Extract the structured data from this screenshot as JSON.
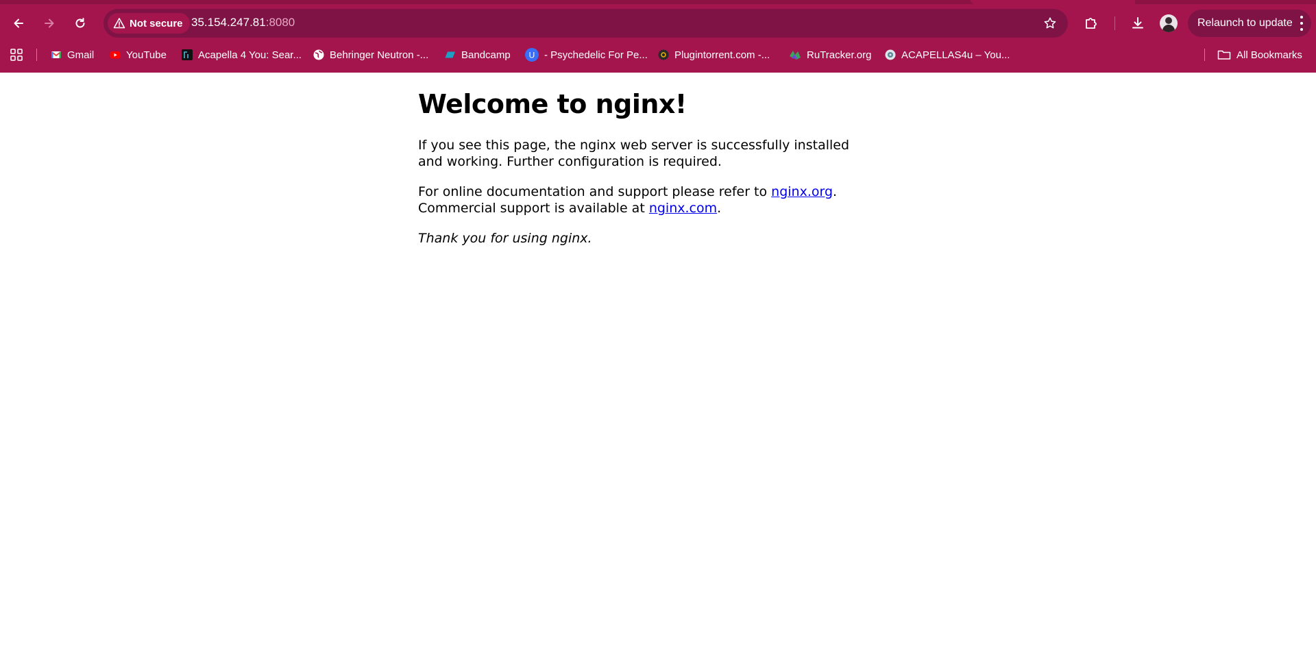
{
  "browser": {
    "security_chip": "Not secure",
    "url_host": "35.154.247.81",
    "url_port": ":8080",
    "relaunch_label": "Relaunch to update",
    "bookmarks": [
      {
        "label": "Gmail",
        "icon": "gmail-icon"
      },
      {
        "label": "YouTube",
        "icon": "youtube-icon"
      },
      {
        "label": "Acapella 4 You: Sear...",
        "icon": "acapella-icon"
      },
      {
        "label": "Behringer Neutron -...",
        "icon": "globe-icon"
      },
      {
        "label": "Bandcamp",
        "icon": "bandcamp-icon"
      },
      {
        "label": "- Psychedelic For Pe...",
        "icon": "u-icon"
      },
      {
        "label": "Plugintorrent.com -...",
        "icon": "plugintorrent-icon"
      },
      {
        "label": "RuTracker.org",
        "icon": "rutracker-icon"
      },
      {
        "label": "ACAPELLAS4u – You...",
        "icon": "acapellas4u-icon"
      }
    ],
    "all_bookmarks_label": "All Bookmarks"
  },
  "page": {
    "title": "Welcome to nginx!",
    "para1": "If you see this page, the nginx web server is successfully installed and working. Further configuration is required.",
    "para2_prefix": "For online documentation and support please refer to ",
    "para2_link1": "nginx.org",
    "para2_mid": ".",
    "para2_line2_prefix": "Commercial support is available at ",
    "para2_link2": "nginx.com",
    "para2_suffix": ".",
    "thanks": "Thank you for using nginx."
  },
  "colors": {
    "frame": "#a3154c",
    "omnibox": "#7f1346",
    "link": "#0000ee"
  }
}
